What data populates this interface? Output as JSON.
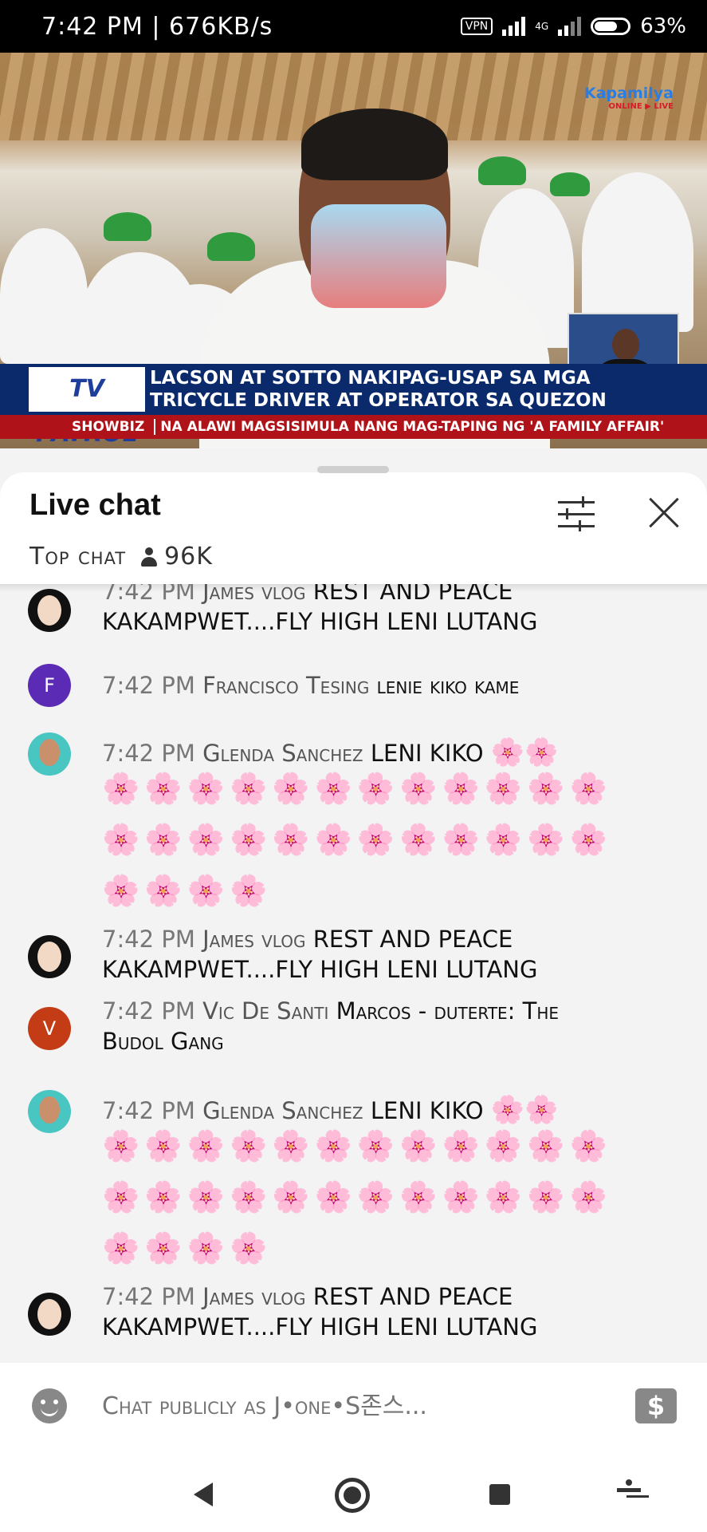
{
  "status_bar": {
    "time_speed": "7:42 PM | 676KB/s",
    "vpn": "VPN",
    "network": "4G",
    "battery": "63%"
  },
  "video": {
    "channel_logo": "Kapamilya",
    "channel_logo_sub": "ONLINE ▶ LIVE",
    "program_logo": "TV PATROL",
    "headline_line1": "LACSON AT SOTTO NAKIPAG-USAP SA MGA",
    "headline_line2": "TRICYCLE DRIVER AT OPERATOR SA QUEZON",
    "ticker_tag": "SHOWBIZ",
    "ticker_text": "NA ALAWI MAGSISIMULA NANG MAG-TAPING NG 'A FAMILY AFFAIR'"
  },
  "chat": {
    "title": "Live chat",
    "mode": "Top chat",
    "viewers": "96K",
    "messages": [
      {
        "time": "7:42 PM",
        "author": "James vlog",
        "text": "REST AND PEACE",
        "text2": "KAKAMPWET....FLY HIGH LENI LUTANG",
        "avatar": "photo"
      },
      {
        "time": "7:42 PM",
        "author": "Francisco Tesing",
        "text": "lenie kiko kame",
        "avatar": "F"
      },
      {
        "time": "7:42 PM",
        "author": "Glenda Sanchez",
        "text": "LENI KIKO",
        "flowers_row1": "🌸🌸",
        "flowers_row2": "🌸🌸🌸🌸🌸🌸🌸🌸🌸🌸🌸🌸",
        "flowers_row3": "🌸🌸🌸🌸🌸🌸🌸🌸🌸🌸🌸🌸",
        "flowers_row4": "🌸🌸🌸🌸",
        "avatar": "photo"
      },
      {
        "time": "7:42 PM",
        "author": "James vlog",
        "text": "REST AND PEACE",
        "text2": "KAKAMPWET....FLY HIGH LENI LUTANG",
        "avatar": "photo"
      },
      {
        "time": "7:42 PM",
        "author": "Vic De Santi",
        "text": "Marcos - duterte: The",
        "text2": "Budol Gang",
        "avatar": "V"
      },
      {
        "time": "7:42 PM",
        "author": "Glenda Sanchez",
        "text": "LENI KIKO",
        "flowers_row1": "🌸🌸",
        "flowers_row2": "🌸🌸🌸🌸🌸🌸🌸🌸🌸🌸🌸🌸",
        "flowers_row3": "🌸🌸🌸🌸🌸🌸🌸🌸🌸🌸🌸🌸",
        "flowers_row4": "🌸🌸🌸🌸",
        "avatar": "photo"
      },
      {
        "time": "7:42 PM",
        "author": "James vlog",
        "text": "REST AND PEACE",
        "text2": "KAKAMPWET....FLY HIGH LENI LUTANG",
        "avatar": "photo"
      }
    ]
  },
  "input": {
    "placeholder": "Chat publicly as J•one•S존스..."
  },
  "icons": {
    "emoji": "smiley-icon",
    "super_chat": "dollar-icon",
    "filter": "sliders-icon",
    "close": "close-icon"
  }
}
